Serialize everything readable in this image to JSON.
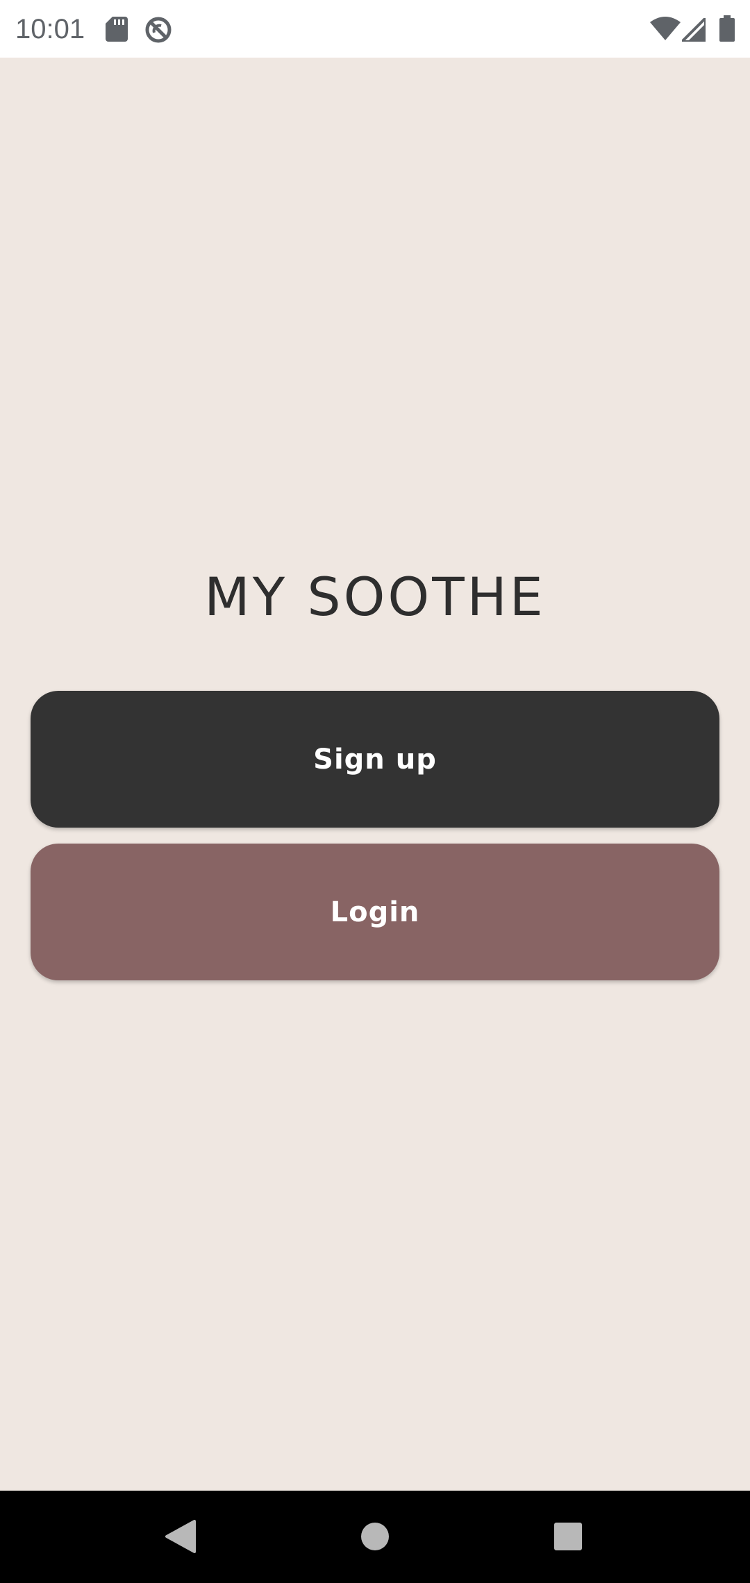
{
  "status_bar": {
    "time": "10:01",
    "left_icons": [
      "sd-card-icon",
      "sync-off-icon"
    ],
    "right_icons": [
      "wifi-icon",
      "cell-signal-icon",
      "battery-icon"
    ]
  },
  "app": {
    "title": "MY SOOTHE",
    "background_color": "#EFE7E1"
  },
  "buttons": {
    "signup": {
      "label": "Sign up",
      "color": "#333333"
    },
    "login": {
      "label": "Login",
      "color": "#886464"
    }
  },
  "nav_bar": {
    "items": [
      "back-icon",
      "home-icon",
      "recents-icon"
    ]
  }
}
